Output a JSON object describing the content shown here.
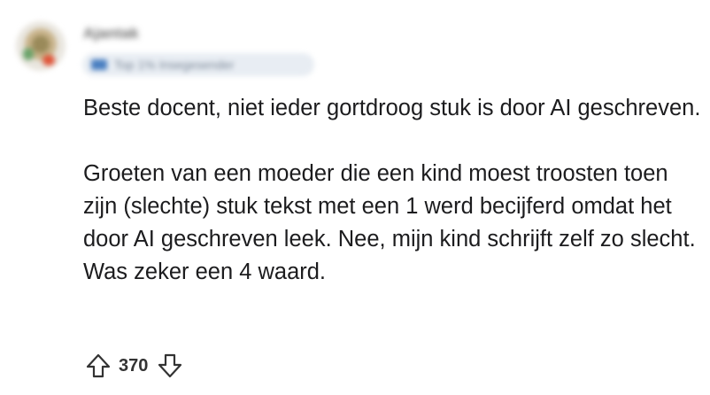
{
  "comment": {
    "author": "Ajantak",
    "flair": "Top 1% Insegesender",
    "paragraphs": [
      "Beste docent, niet ieder gortdroog stuk is door AI geschreven.",
      "Groeten van een moeder die een kind moest troosten toen zijn (slechte) stuk tekst met een 1 werd becijferd omdat het door AI geschreven leek. Nee, mijn kind schrijft zelf zo slecht. Was zeker een 4 waard."
    ]
  },
  "votes": {
    "count": "370",
    "upvote_icon": "arrow-up-outline-icon",
    "downvote_icon": "arrow-down-outline-icon"
  },
  "colors": {
    "text": "#1c1c1e",
    "icon": "#333333",
    "flair_bg": "#e8edf3"
  }
}
